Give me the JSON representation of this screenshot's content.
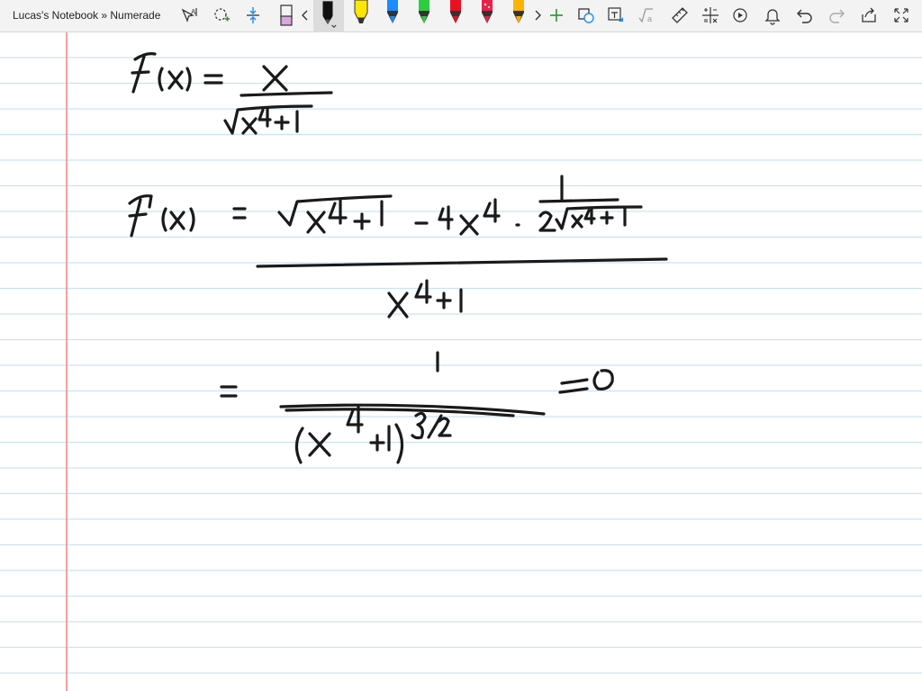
{
  "window": {
    "breadcrumb": "Lucas's Notebook » Numerade"
  },
  "toolbar": {
    "tools": [
      {
        "name": "type-select-icon"
      },
      {
        "name": "lasso-select-icon"
      },
      {
        "name": "insert-space-icon"
      },
      {
        "name": "eraser-icon"
      },
      {
        "name": "scroll-left-icon"
      },
      {
        "name": "pen-black-icon"
      },
      {
        "name": "highlighter-yellow-icon"
      },
      {
        "name": "pen-blue-icon"
      },
      {
        "name": "pen-green-icon"
      },
      {
        "name": "pen-red-icon"
      },
      {
        "name": "pen-crimson-icon"
      },
      {
        "name": "pen-orange-icon"
      },
      {
        "name": "scroll-right-icon"
      },
      {
        "name": "add-pen-icon"
      },
      {
        "name": "ink-to-shape-icon"
      },
      {
        "name": "ink-to-text-icon"
      },
      {
        "name": "ink-to-math-icon"
      },
      {
        "name": "ruler-icon"
      },
      {
        "name": "math-icon"
      },
      {
        "name": "replay-icon"
      },
      {
        "name": "undo-icon"
      },
      {
        "name": "redo-icon"
      },
      {
        "name": "share-icon"
      },
      {
        "name": "expand-icon"
      }
    ],
    "pen_colors": {
      "eraser": "#d9a6e0",
      "black": "#111111",
      "yellow": "#ffe600",
      "blue": "#1a8cff",
      "green": "#2ecc40",
      "red": "#e81123",
      "crimson": "#e8224a",
      "orange": "#ffb300"
    },
    "accent": "#2f8f2f"
  },
  "page": {
    "rule_color": "#c9e3f5",
    "margin_color": "#f08080",
    "ink_color": "#1a1a1a"
  }
}
